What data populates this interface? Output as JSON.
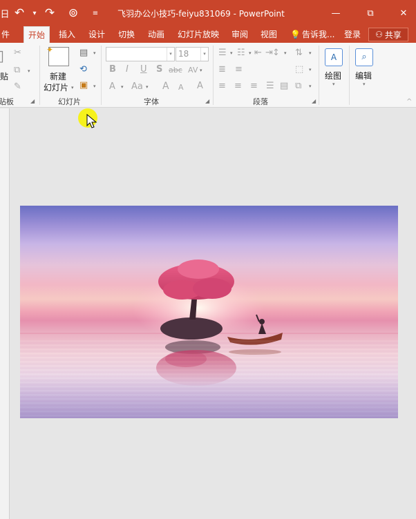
{
  "window": {
    "title": "飞羽办公小技巧-feiyu831069 - PowerPoint",
    "minimize_glyph": "—",
    "restore_glyph": "⧉",
    "close_glyph": "✕"
  },
  "quick_access": {
    "save_glyph": "日",
    "undo_glyph": "↶",
    "undo_dd_glyph": "▾",
    "redo_glyph": "↷",
    "present_glyph": "⊚",
    "customize_glyph": "≡"
  },
  "tabs": [
    {
      "label": "件"
    },
    {
      "label": "开始"
    },
    {
      "label": "插入"
    },
    {
      "label": "设计"
    },
    {
      "label": "切换"
    },
    {
      "label": "动画"
    },
    {
      "label": "幻灯片放映"
    },
    {
      "label": "审阅"
    },
    {
      "label": "视图"
    }
  ],
  "tell_me": {
    "label": "告诉我..."
  },
  "signin": {
    "label": "登录"
  },
  "share": {
    "label": "共享",
    "icon_glyph": "⚇"
  },
  "ribbon": {
    "clipboard": {
      "label": "贴板",
      "paste_label": "贴"
    },
    "slides": {
      "label": "幻灯片",
      "new_slide_line1": "新建",
      "new_slide_line2": "幻灯片"
    },
    "font": {
      "label": "字体",
      "font_name": "",
      "font_size": "18",
      "bold": "B",
      "italic": "I",
      "underline": "U",
      "shadow": "S",
      "strike": "abc",
      "spacing": "AV",
      "font_color": "A",
      "case": "Aa",
      "grow": "A",
      "shrink": "A",
      "clear": "A"
    },
    "paragraph": {
      "label": "段落"
    },
    "drawing": {
      "label": "绘图"
    },
    "editing": {
      "label": "编辑"
    },
    "collapse_glyph": "^"
  },
  "colors": {
    "accent": "#c9452b",
    "ribbon_bg": "#f6f6f6",
    "workspace_bg": "#e6e6e6",
    "cursor_halo": "#f7f211"
  }
}
